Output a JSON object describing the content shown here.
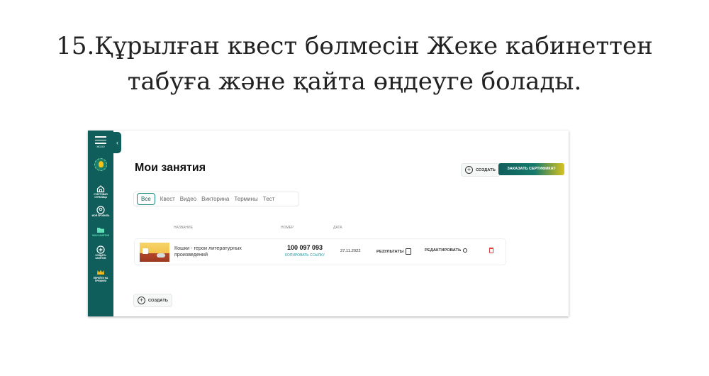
{
  "heading": {
    "line1": "15.Құрылған квест бөлмесін Жеке кабинеттен",
    "line2": "табуға және қайта өңдеуге болады."
  },
  "sidebar": {
    "brand": "MOJIO",
    "items": [
      {
        "icon": "home-icon",
        "label": "СТАРТОВАЯ СТРАНИЦА"
      },
      {
        "icon": "profile-icon",
        "label": "МОЙ ПРОФИЛЬ"
      },
      {
        "icon": "folder-icon",
        "label": "МОИ ЗАНЯТИЯ"
      },
      {
        "icon": "plus-circle-icon",
        "label": "СОЗДАТЬ ЗАНЯТИЕ"
      },
      {
        "icon": "crown-icon",
        "label": "ПЕРЕЙТИ НА ПРЕМИУМ"
      }
    ]
  },
  "main": {
    "title": "Мои занятия",
    "create_label": "СОЗДАТЬ",
    "certificate_label": "ЗАКАЗАТЬ СЕРТИФИКАТ",
    "tabs": [
      "Все",
      "Квест",
      "Видео",
      "Викторина",
      "Термины",
      "Тест"
    ],
    "active_tab": "Все",
    "columns": [
      "НАЗВАНИЕ",
      "НОМЕР",
      "ДАТА"
    ],
    "rows": [
      {
        "name": "Кошки - герои литературных произведений",
        "number": "100 097 093",
        "copy_link": "КОПИРОВАТЬ ССЫЛКУ",
        "date": "27.11.2022",
        "results": "РЕЗУЛЬТАТЫ",
        "edit": "РЕДАКТИРОВАТЬ"
      }
    ],
    "bottom_create_label": "СОЗДАТЬ"
  },
  "colors": {
    "sidebar": "#0f5e5b",
    "accent": "#1c9aa3",
    "delete": "#e23b3b",
    "certificate_gradient_end": "#d9c21d"
  }
}
